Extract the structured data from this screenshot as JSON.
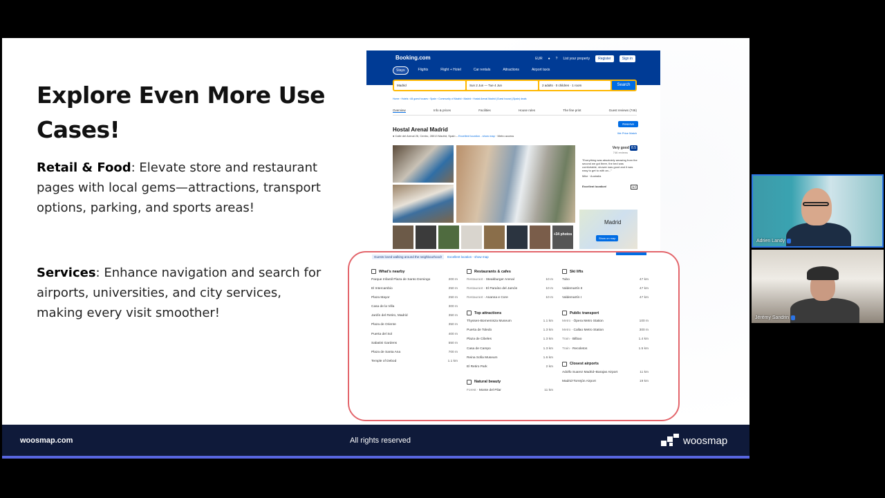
{
  "slide": {
    "heading": "Explore Even More Use Cases!",
    "retail_label": "Retail & Food",
    "retail_text": ": Elevate store and restaurant pages with local gems—attractions, transport options, parking, and sports areas!",
    "services_label": "Services",
    "services_text": ": Enhance navigation and search for airports, universities, and city services, making every visit smoother!"
  },
  "footer": {
    "site": "woosmap.com",
    "rights": "All rights reserved",
    "brand": "woosmap"
  },
  "booking": {
    "logo": "Booking.com",
    "currency": "EUR",
    "list_property": "List your property",
    "register": "Register",
    "sign_in": "Sign in",
    "nav": [
      "Stays",
      "Flights",
      "Flight + Hotel",
      "Car rentals",
      "Attractions",
      "Airport taxis"
    ],
    "search": {
      "destination": "Madrid",
      "dates": "Sun 2 Jun — Tue 4 Jun",
      "guests": "2 adults · 0 children · 1 room",
      "button": "Search"
    },
    "breadcrumbs": "Home › Hotels › All guest houses › Spain › Community of Madrid › Madrid › Hostal Arenal Madrid (Guest house) (Spain) deals",
    "tabs": [
      "Overview",
      "Info & prices",
      "Facilities",
      "House rules",
      "The fine print",
      "Guest reviews (746)"
    ],
    "hotel_name": "Hostal Arenal Madrid",
    "address": "Calle del Arenal 26, Centro, 28013 Madrid, Spain –",
    "address_link": "Excellent location - show map",
    "address_tail": "· Metro access",
    "reserve": "Reserve",
    "price_match": "We Price Match",
    "score_label": "Very good",
    "score_reviews": "746 reviews",
    "score": "8.5",
    "review_quote": "\"Everything was absolutely amazing from the second we got there, the bed was comfortable, shower was good and it was easy to get to with an...\"",
    "reviewer": "Mike",
    "reviewer_country": "Australia",
    "location_label": "Excellent location!",
    "location_score": "9.7",
    "more_photos": "+34 photos",
    "map_label": "Madrid",
    "show_on_map": "Show on map"
  },
  "surroundings": {
    "tag": "Guests loved walking around the neighbourhood!",
    "link": "Excellent location - show map",
    "sections": [
      {
        "title": "What's nearby",
        "icon": "walk-icon",
        "column": 1,
        "rows": [
          {
            "name": "Parque Infantil Plaza de Santo Domingo",
            "dist": "200 m"
          },
          {
            "name": "El Intercambio",
            "dist": "250 m"
          },
          {
            "name": "Plaza Mayor",
            "dist": "250 m"
          },
          {
            "name": "Casa de la Villa",
            "dist": "300 m"
          },
          {
            "name": "Jardín del Retiro, Madrid",
            "dist": "350 m"
          },
          {
            "name": "Plaza de Oriente",
            "dist": "350 m"
          },
          {
            "name": "Puerta del Sol",
            "dist": "400 m"
          },
          {
            "name": "Sabatini Gardens",
            "dist": "550 m"
          },
          {
            "name": "Plaza de Santa Ana",
            "dist": "700 m"
          },
          {
            "name": "Temple of Debod",
            "dist": "1.1 km"
          }
        ]
      },
      {
        "title": "Restaurants & cafes",
        "icon": "cutlery-icon",
        "column": 2,
        "rows": [
          {
            "type": "Restaurant",
            "name": "Steakburger Arenal",
            "dist": "10 m"
          },
          {
            "type": "Restaurant",
            "name": "El Paraíso del Jamón",
            "dist": "10 m"
          },
          {
            "type": "Restaurant",
            "name": "Ananna e Core",
            "dist": "10 m"
          }
        ]
      },
      {
        "title": "Top attractions",
        "icon": "attractions-icon",
        "column": 2,
        "rows": [
          {
            "name": "Thyssen-Bornemisza Museum",
            "dist": "1.1 km"
          },
          {
            "name": "Puerta de Toledo",
            "dist": "1.3 km"
          },
          {
            "name": "Plaza de Cibeles",
            "dist": "1.3 km"
          },
          {
            "name": "Casa de Campo",
            "dist": "1.3 km"
          },
          {
            "name": "Reina Sofia Museum",
            "dist": "1.6 km"
          },
          {
            "name": "El Retiro Park",
            "dist": "2 km"
          }
        ]
      },
      {
        "title": "Natural beauty",
        "icon": "mountain-icon",
        "column": 2,
        "rows": [
          {
            "type": "Forest",
            "name": "Monte del Pilar",
            "dist": "11 km"
          }
        ]
      },
      {
        "title": "Ski lifts",
        "icon": "ski-lift-icon",
        "column": 3,
        "rows": [
          {
            "name": "Tubo",
            "dist": "47 km"
          },
          {
            "name": "Valdemartín II",
            "dist": "47 km"
          },
          {
            "name": "Valdemartín I",
            "dist": "47 km"
          }
        ]
      },
      {
        "title": "Public transport",
        "icon": "train-icon",
        "column": 3,
        "rows": [
          {
            "type": "Metro",
            "name": "Ópera Metro Station",
            "dist": "100 m"
          },
          {
            "type": "Metro",
            "name": "Callao Metro Station",
            "dist": "300 m"
          },
          {
            "type": "Train",
            "name": "Bilbao",
            "dist": "1.4 km"
          },
          {
            "type": "Train",
            "name": "Recoletos",
            "dist": "1.5 km"
          }
        ]
      },
      {
        "title": "Closest airports",
        "icon": "plane-icon",
        "column": 3,
        "rows": [
          {
            "name": "Adolfo Suarez Madrid–Barajas Airport",
            "dist": "11 km"
          },
          {
            "name": "Madrid-Torrejón Airport",
            "dist": "19 km"
          }
        ]
      }
    ]
  },
  "participants": [
    {
      "name": "Adrien Landy"
    },
    {
      "name": "Jérémy Sandrin"
    }
  ]
}
